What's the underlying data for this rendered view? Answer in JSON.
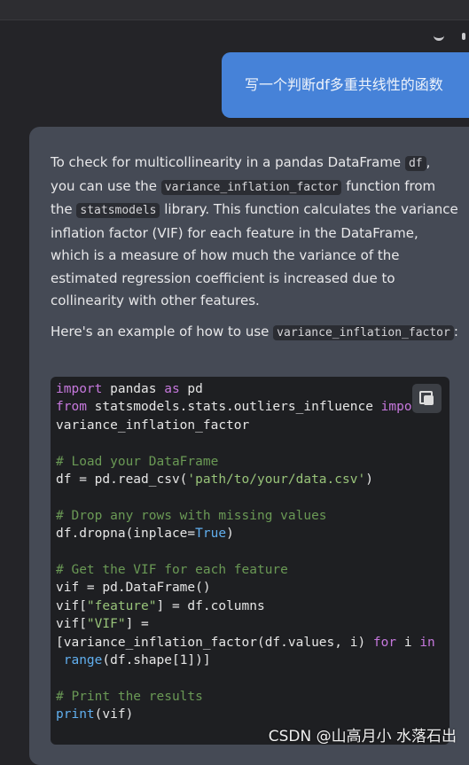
{
  "user_message": "写一个判断df多重共线性的函数",
  "assistant": {
    "p1_a": "To check for multicollinearity in a pandas DataFrame ",
    "p1_code1": "df",
    "p1_b": ", you can use the ",
    "p1_code2": "variance_inflation_factor",
    "p1_c": " function from the ",
    "p1_code3": "statsmodels",
    "p1_d": " library. This function calculates the variance inflation factor (VIF) for each feature in the DataFrame, which is a measure of how much the variance of the estimated regression coefficient is increased due to collinearity with other features.",
    "p2_a": "Here's an example of how to use ",
    "p2_code": "variance_inflation_factor",
    "p2_b": ":"
  },
  "code_lines": [
    "import pandas as pd",
    "from statsmodels.stats.outliers_influence import",
    "variance_inflation_factor",
    "",
    "# Load your DataFrame",
    "df = pd.read_csv('path/to/your/data.csv')",
    "",
    "# Drop any rows with missing values",
    "df.dropna(inplace=True)",
    "",
    "# Get the VIF for each feature",
    "vif = pd.DataFrame()",
    "vif[\"feature\"] = df.columns",
    "vif[\"VIF\"] =",
    "[variance_inflation_factor(df.values, i) for i in",
    " range(df.shape[1])]",
    "",
    "# Print the results",
    "print(vif)"
  ],
  "copy_button": {
    "icon": "copy-icon"
  },
  "watermark": "CSDN @山高月小 水落石出"
}
